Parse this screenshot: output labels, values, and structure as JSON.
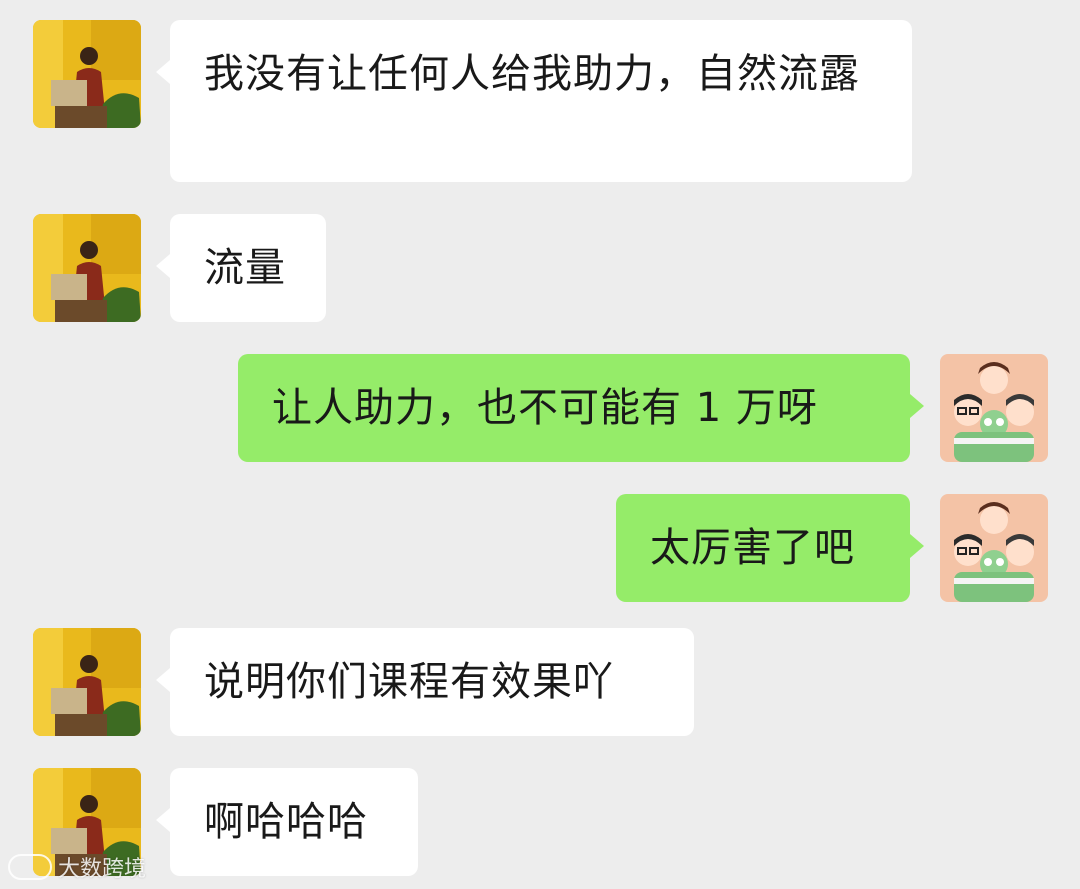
{
  "chat": {
    "messages": [
      {
        "side": "left",
        "sender": "contact",
        "text": "我没有让任何人给我助力，自然流露"
      },
      {
        "side": "left",
        "sender": "contact",
        "text": "流量"
      },
      {
        "side": "right",
        "sender": "self",
        "text": "让人助力，也不可能有 1 万呀"
      },
      {
        "side": "right",
        "sender": "self",
        "text": "太厉害了吧"
      },
      {
        "side": "left",
        "sender": "contact",
        "text": "说明你们课程有效果吖"
      },
      {
        "side": "left",
        "sender": "contact",
        "text": "啊哈哈哈"
      }
    ]
  },
  "watermark": {
    "text": "大数跨境"
  },
  "colors": {
    "background": "#ededed",
    "incoming_bubble": "#ffffff",
    "outgoing_bubble": "#95ec69",
    "text": "#191919"
  },
  "icons": {
    "contact_avatar": "avatar-photo-yellow",
    "self_avatar": "avatar-cartoon-group"
  }
}
